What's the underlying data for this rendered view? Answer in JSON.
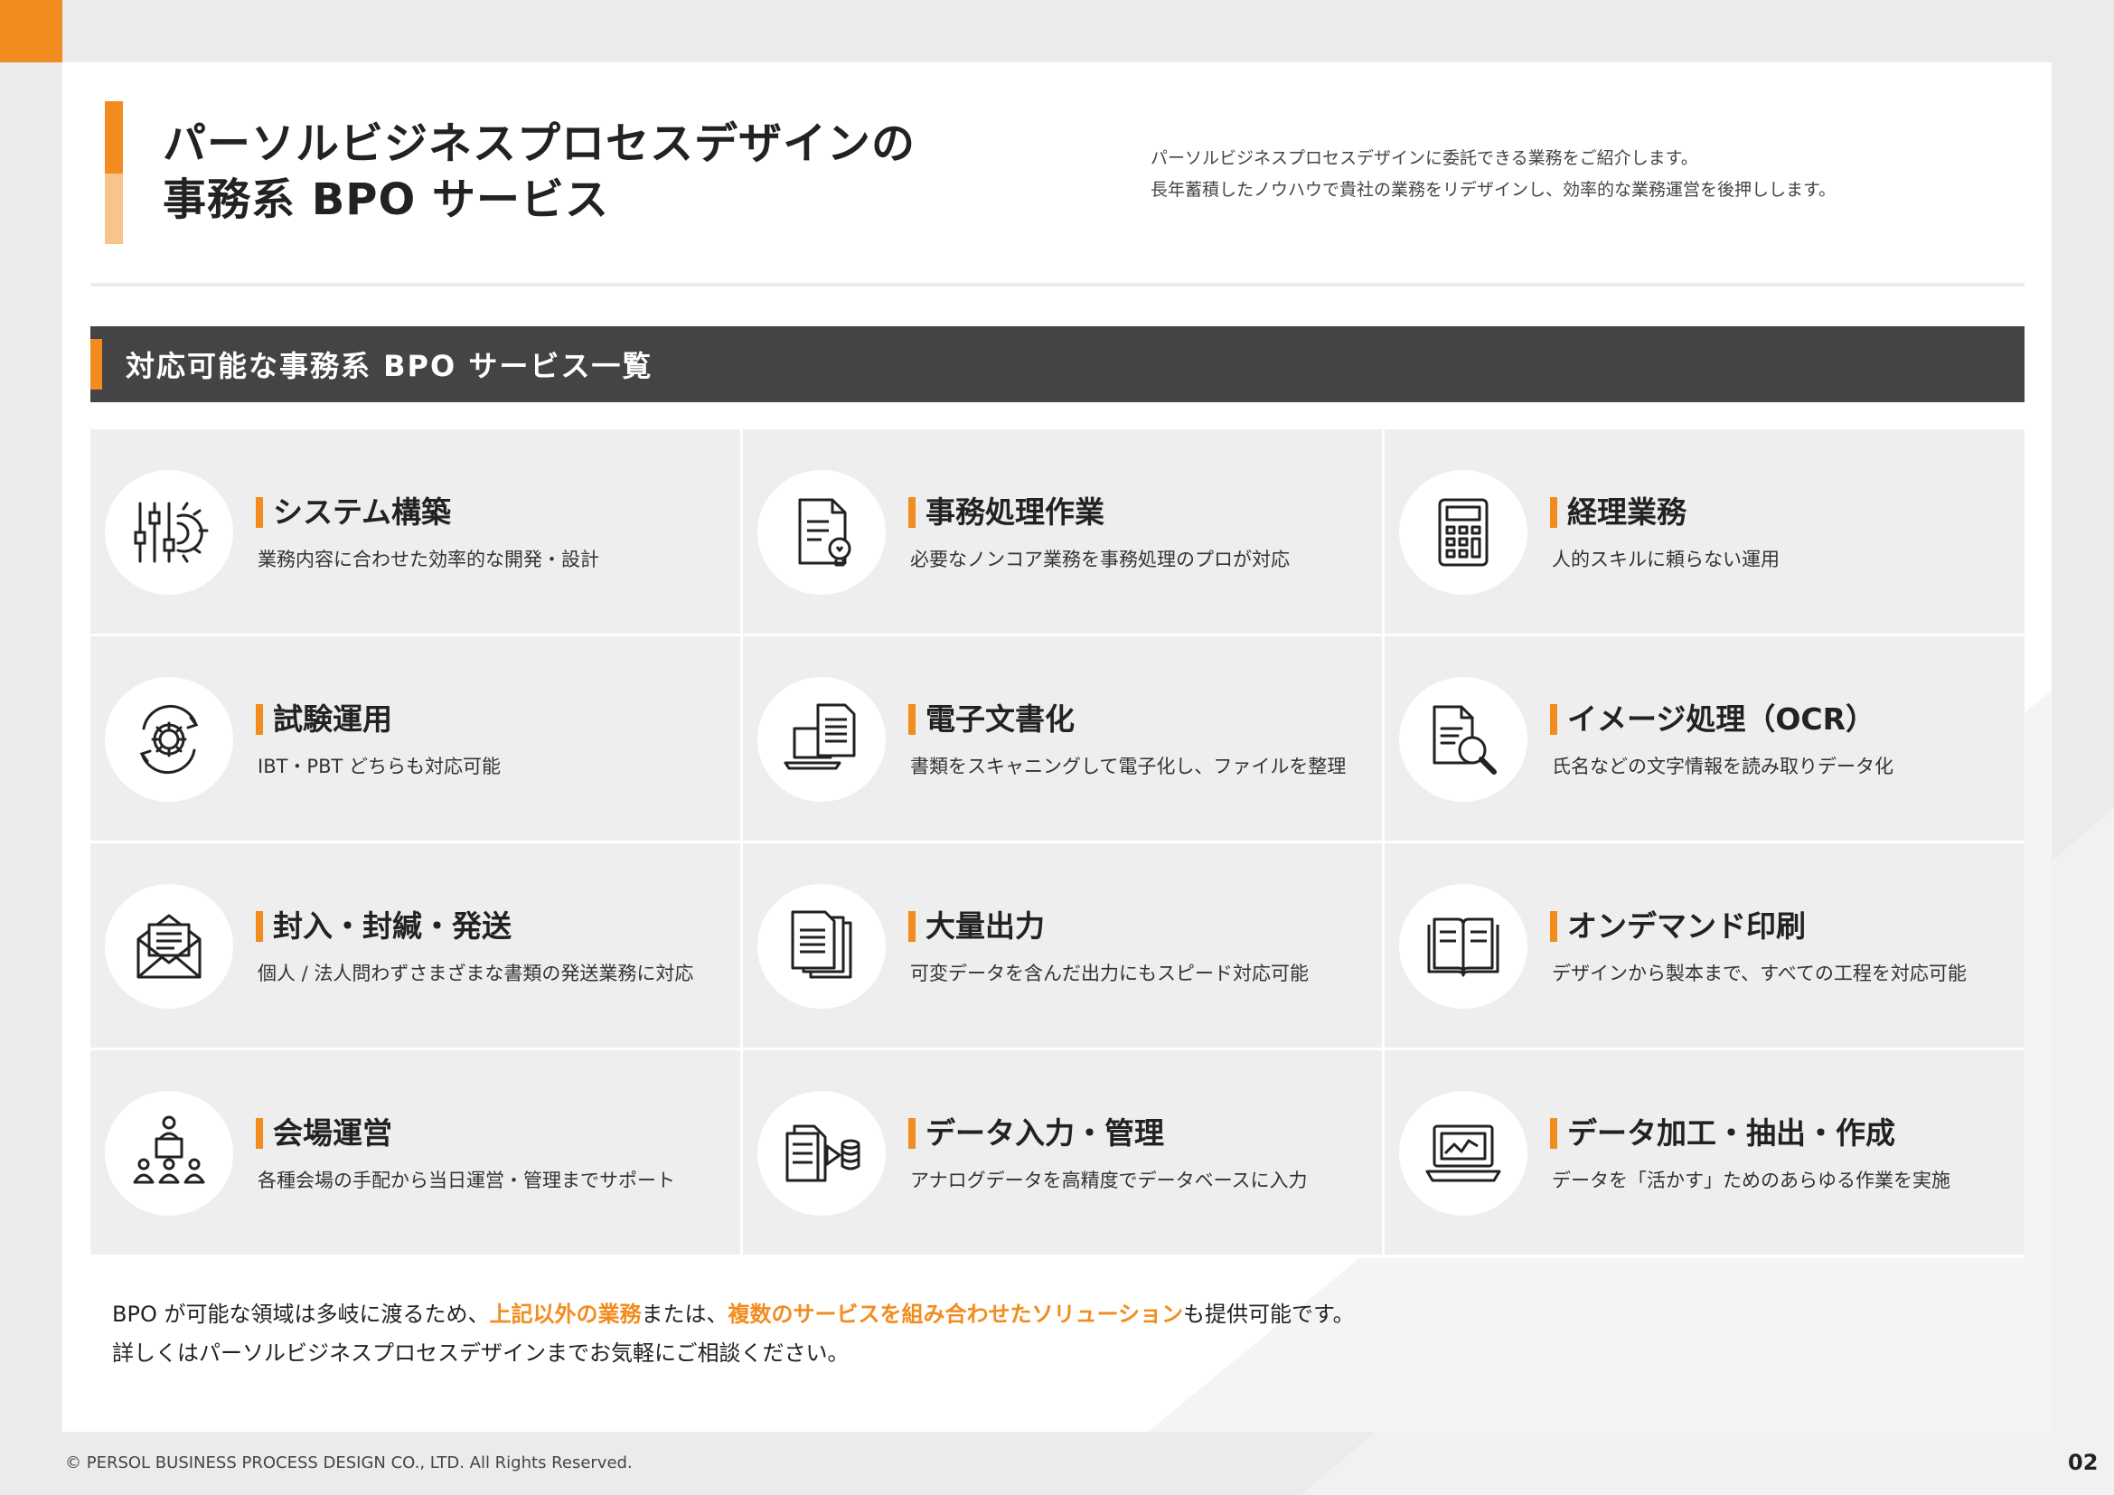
{
  "header": {
    "title_line1": "パーソルビジネスプロセスデザインの",
    "title_line2": "事務系 BPO サービス",
    "intro_line1": "パーソルビジネスプロセスデザインに委託できる業務をご紹介します。",
    "intro_line2": "長年蓄積したノウハウで貴社の業務をリデザインし、効率的な業務運営を後押しします。"
  },
  "section": {
    "title": "対応可能な事務系 BPO サービス一覧"
  },
  "services": [
    {
      "title": "システム構築",
      "desc": "業務内容に合わせた効率的な開発・設計",
      "icon": "system-gear-icon"
    },
    {
      "title": "事務処理作業",
      "desc": "必要なノンコア業務を事務処理のプロが対応",
      "icon": "document-bulb-icon"
    },
    {
      "title": "経理業務",
      "desc": "人的スキルに頼らない運用",
      "icon": "calculator-icon"
    },
    {
      "title": "試験運用",
      "desc": "IBT・PBT どちらも対応可能",
      "icon": "gear-cycle-icon"
    },
    {
      "title": "電子文書化",
      "desc": "書類をスキャニングして電子化し、ファイルを整理",
      "icon": "laptop-document-icon"
    },
    {
      "title": "イメージ処理（OCR）",
      "desc": "氏名などの文字情報を読み取りデータ化",
      "icon": "document-search-icon"
    },
    {
      "title": "封入・封緘・発送",
      "desc": "個人 / 法人問わずさまざまな書類の発送業務に対応",
      "icon": "envelope-icon"
    },
    {
      "title": "大量出力",
      "desc": "可変データを含んだ出力にもスピード対応可能",
      "icon": "document-stack-icon"
    },
    {
      "title": "オンデマンド印刷",
      "desc": "デザインから製本まで、すべての工程を対応可能",
      "icon": "open-book-icon"
    },
    {
      "title": "会場運営",
      "desc": "各種会場の手配から当日運営・管理までサポート",
      "icon": "presenter-audience-icon"
    },
    {
      "title": "データ入力・管理",
      "desc": "アナログデータを高精度でデータベースに入力",
      "icon": "document-database-icon"
    },
    {
      "title": "データ加工・抽出・作成",
      "desc": "データを「活かす」ためのあらゆる作業を実施",
      "icon": "laptop-chart-icon"
    }
  ],
  "footnote": {
    "line1_a": "BPO が可能な領域は多岐に渡るため、",
    "line1_hl1": "上記以外の業務",
    "line1_b": "または、",
    "line1_hl2": "複数のサービスを組み合わせたソリューション",
    "line1_c": "も提供可能です。",
    "line2": "詳しくはパーソルビジネスプロセスデザインまでお気軽にご相談ください。"
  },
  "footer": {
    "copyright": "© PERSOL BUSINESS PROCESS DESIGN CO., LTD. All Rights Reserved.",
    "page": "02"
  },
  "colors": {
    "accent": "#f28c1e",
    "accent_light": "#f7c48a",
    "header_bar": "#444444",
    "cell_bg": "#eeeeee"
  }
}
